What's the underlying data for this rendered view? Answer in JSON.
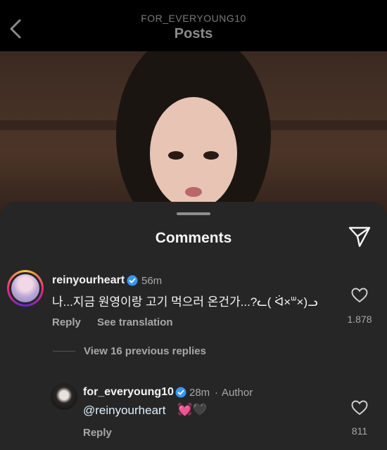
{
  "header": {
    "account_name": "FOR_EVERYOUNG10",
    "title": "Posts"
  },
  "sheet": {
    "title": "Comments"
  },
  "comments": [
    {
      "username": "reinyourheart",
      "verified": true,
      "time": "56m",
      "text": "나...지금 원영이랑 고기 먹으러 온건가...?ᓚ( ᐛ×ᐜ×)ᓗ",
      "reply_label": "Reply",
      "translate_label": "See translation",
      "likes": "1.878"
    }
  ],
  "view_replies_label": "View 16 previous replies",
  "reply": {
    "username": "for_everyoung10",
    "verified": true,
    "time": "28m",
    "author_tag": "Author",
    "separator": "·",
    "mention": "@reinyourheart",
    "emojis": "💓🖤",
    "reply_label": "Reply",
    "likes": "811"
  },
  "colors": {
    "sheet_bg": "#262626",
    "verified_blue": "#3897f0",
    "secondary_text": "#a8a8a8"
  }
}
